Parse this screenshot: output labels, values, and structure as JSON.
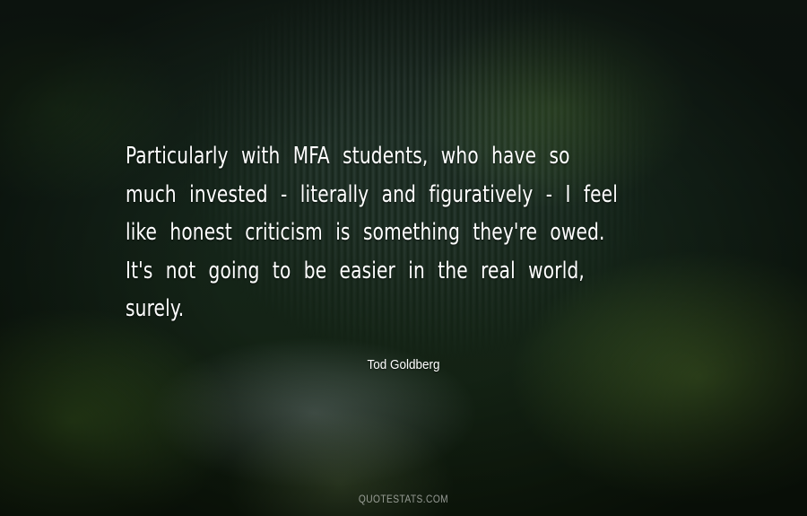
{
  "quote": {
    "lines": [
      "Particularly with MFA students, who have so",
      "much invested - literally and figuratively - I feel",
      "like honest criticism is something they're owed.",
      "It's not going to be easier in the real world,",
      "surely."
    ]
  },
  "author": "Tod Goldberg",
  "watermark": "QUOTESTATS.COM"
}
